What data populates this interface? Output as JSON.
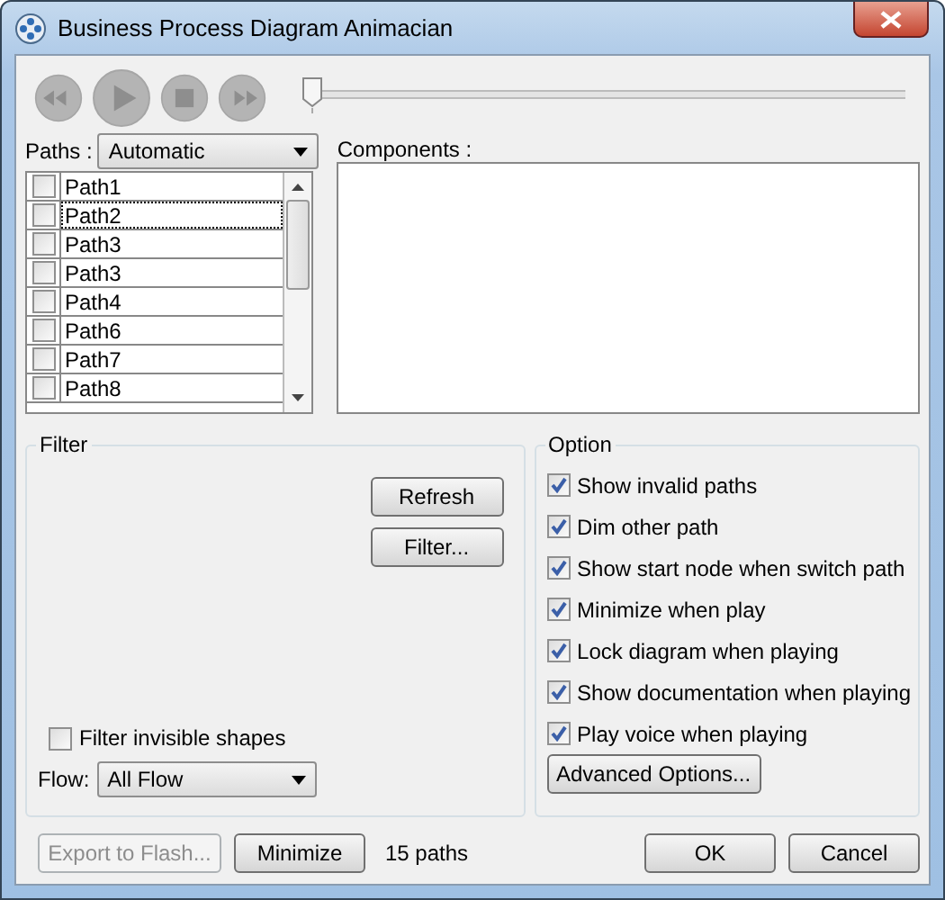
{
  "window": {
    "title": "Business Process Diagram Animacian"
  },
  "playback": {
    "buttons": [
      {
        "kind": "rewind",
        "disabled": true
      },
      {
        "kind": "play",
        "disabled": true
      },
      {
        "kind": "stop",
        "disabled": true
      },
      {
        "kind": "forward",
        "disabled": true
      }
    ],
    "level": 0
  },
  "paths": {
    "label": "Paths :",
    "mode": "Automatic",
    "items": [
      {
        "label": "Path1",
        "checked": false,
        "focused": false
      },
      {
        "label": "Path2",
        "checked": false,
        "focused": true
      },
      {
        "label": "Path3",
        "checked": false,
        "focused": false
      },
      {
        "label": "Path3",
        "checked": false,
        "focused": false
      },
      {
        "label": "Path4",
        "checked": false,
        "focused": false
      },
      {
        "label": "Path6",
        "checked": false,
        "focused": false
      },
      {
        "label": "Path7",
        "checked": false,
        "focused": false
      },
      {
        "label": "Path8",
        "checked": false,
        "focused": false
      }
    ]
  },
  "components": {
    "label": "Components :"
  },
  "filter": {
    "title": "Filter",
    "buttons": [
      "Refresh",
      "Filter..."
    ],
    "invisible_shapes": {
      "label": "Filter invisible shapes",
      "checked": false
    },
    "flow": {
      "label": "Flow:",
      "value": "All Flow"
    }
  },
  "option": {
    "title": "Option",
    "items": [
      {
        "label": "Show invalid paths",
        "checked": true
      },
      {
        "label": "Dim other path",
        "checked": true
      },
      {
        "label": "Show start node when switch path",
        "checked": true
      },
      {
        "label": "Minimize when play",
        "checked": true
      },
      {
        "label": "Lock diagram when playing",
        "checked": true
      },
      {
        "label": "Show documentation when playing",
        "checked": true
      },
      {
        "label": "Play voice when playing",
        "checked": true
      }
    ],
    "button": "Advanced Options..."
  },
  "footer": {
    "buttons": [
      {
        "label": "Export to Flash...",
        "disabled": true
      },
      {
        "label": "Minimize",
        "disabled": false
      }
    ],
    "count": "15 paths",
    "dialog_buttons": [
      "OK",
      "Cancel"
    ]
  }
}
